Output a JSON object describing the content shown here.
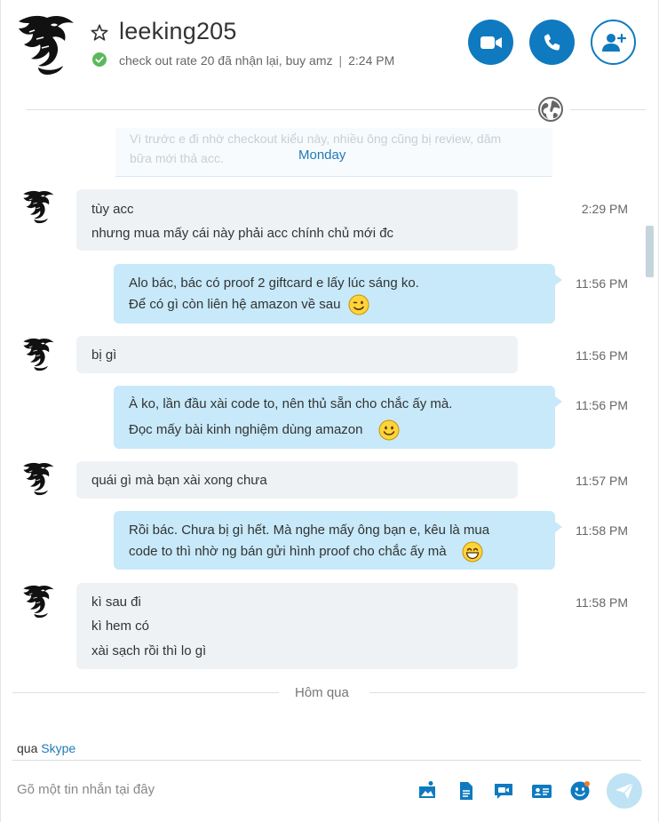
{
  "header": {
    "contact_name": "leeking205",
    "mood": "check out rate 20 đã nhận lại, buy amz",
    "mood_separator": "|",
    "mood_time": "2:24 PM",
    "presence_color": "#5cb85c",
    "accent_color": "#0f7abf",
    "icons": [
      "star-icon",
      "presence-online-icon",
      "video-call-icon",
      "phone-icon",
      "add-person-icon",
      "globe-icon"
    ]
  },
  "preview": {
    "faded_text": "Vì trước e đi nhờ checkout kiểu này, nhiều ông cũng bị review, dăm bữa mới thả acc.",
    "day_label": "Monday"
  },
  "messages": [
    {
      "side": "in",
      "lines": [
        "tùy acc",
        "nhưng mua mấy cái này phải acc chính chủ mới đc"
      ],
      "time": "2:29 PM"
    },
    {
      "side": "out",
      "lines": [
        "Alo bác, bác có proof 2 giftcard e lấy lúc sáng ko.",
        "Để có gì còn liên hệ amazon về sau"
      ],
      "emoji": "wink-emoji-icon",
      "time": "11:56 PM"
    },
    {
      "side": "in",
      "lines": [
        "bị gì"
      ],
      "time": "11:56 PM"
    },
    {
      "side": "out",
      "lines": [
        "À ko, lần đầu xài code to, nên thủ sẵn cho chắc ấy mà.",
        "Đọc mấy bài kinh nghiệm dùng amazon"
      ],
      "emoji": "smile-emoji-icon",
      "time": "11:56 PM"
    },
    {
      "side": "in",
      "lines": [
        "quái gì mà bạn xài xong chưa"
      ],
      "time": "11:57 PM"
    },
    {
      "side": "out",
      "lines": [
        "Rồi bác. Chưa bị gì hết. Mà nghe mấy ông bạn e, kêu là mua",
        "code to thì nhờ ng bán gửi hình proof cho chắc ấy mà"
      ],
      "emoji": "grin-emoji-icon",
      "time": "11:58 PM"
    },
    {
      "side": "in",
      "lines": [
        "kì sau đi",
        "kì hem có",
        "xài sạch rồi thì lo gì"
      ],
      "time": "11:58 PM"
    }
  ],
  "day_separator": "Hôm qua",
  "composer": {
    "via_label": "qua",
    "via_link": "Skype",
    "placeholder": "Gõ một tin nhắn tại đây",
    "tools": [
      "send-media-icon",
      "send-file-icon",
      "video-message-icon",
      "send-contact-icon",
      "emoticon-icon",
      "send-icon"
    ]
  }
}
